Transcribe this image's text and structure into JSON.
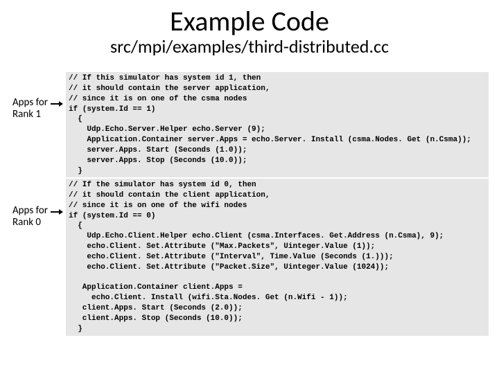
{
  "title": "Example Code",
  "subtitle": "src/mpi/examples/third-distributed.cc",
  "labels": {
    "block1_line1": "Apps for",
    "block1_line2": "Rank 1",
    "block2_line1": "Apps for",
    "block2_line2": "Rank 0"
  },
  "code": {
    "block1": "// If this simulator has system id 1, then\n// it should contain the server application,\n// since it is on one of the csma nodes\nif (system.Id == 1)\n  {\n    Udp.Echo.Server.Helper echo.Server (9);\n    Application.Container server.Apps = echo.Server. Install (csma.Nodes. Get (n.Csma));\n    server.Apps. Start (Seconds (1.0));\n    server.Apps. Stop (Seconds (10.0));\n  }",
    "block2": "// If the simulator has system id 0, then\n// it should contain the client application,\n// since it is on one of the wifi nodes\nif (system.Id == 0)\n  {\n    Udp.Echo.Client.Helper echo.Client (csma.Interfaces. Get.Address (n.Csma), 9);\n    echo.Client. Set.Attribute (\"Max.Packets\", Uinteger.Value (1));\n    echo.Client. Set.Attribute (\"Interval\", Time.Value (Seconds (1.)));\n    echo.Client. Set.Attribute (\"Packet.Size\", Uinteger.Value (1024));\n\n   Application.Container client.Apps =\n     echo.Client. Install (wifi.Sta.Nodes. Get (n.Wifi - 1));\n   client.Apps. Start (Seconds (2.0));\n   client.Apps. Stop (Seconds (10.0));\n  }"
  }
}
